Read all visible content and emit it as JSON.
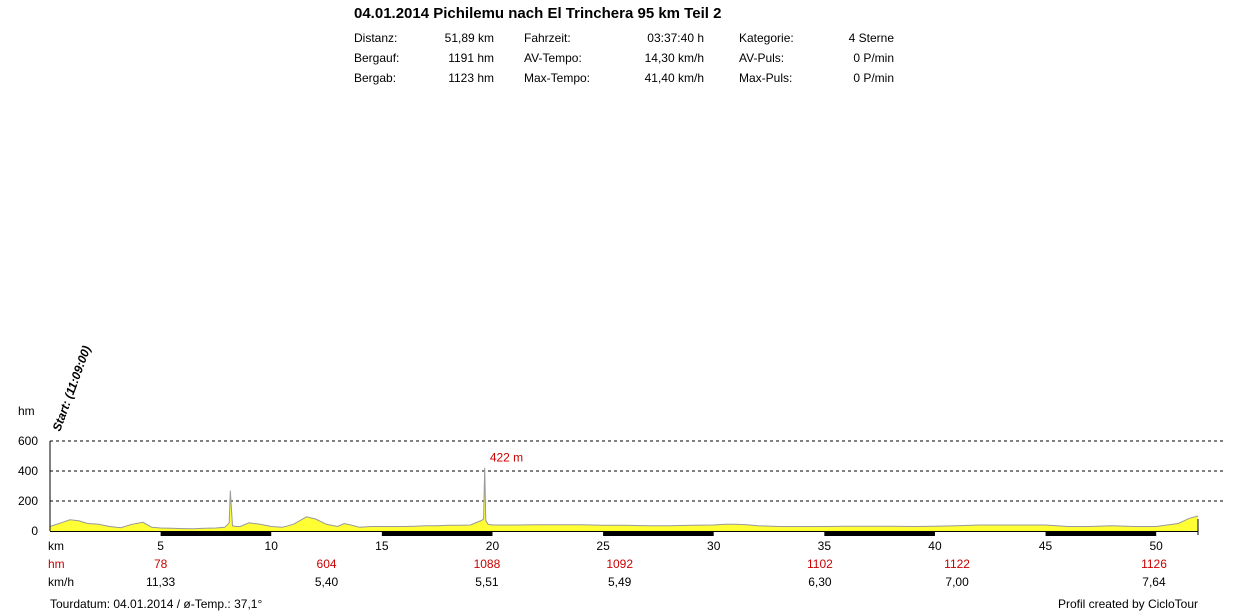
{
  "header": {
    "title": "04.01.2014 Pichilemu nach El Trinchera 95 km Teil 2",
    "stats": [
      {
        "label": "Distanz:",
        "value": "51,89 km"
      },
      {
        "label": "Bergauf:",
        "value": "1191 hm"
      },
      {
        "label": "Bergab:",
        "value": "1123 hm"
      },
      {
        "label": "Fahrzeit:",
        "value": "03:37:40 h"
      },
      {
        "label": "AV-Tempo:",
        "value": "14,30 km/h"
      },
      {
        "label": "Max-Tempo:",
        "value": "41,40 km/h"
      },
      {
        "label": "Kategorie:",
        "value": "4 Sterne"
      },
      {
        "label": "AV-Puls:",
        "value": "0 P/min"
      },
      {
        "label": "Max-Puls:",
        "value": "0 P/min"
      }
    ]
  },
  "footer": {
    "left": "Tourdatum: 04.01.2014  /  ø-Temp.: 37,1°",
    "right": "Profil created by CicloTour"
  },
  "chart_data": {
    "type": "area",
    "xlabel": "km",
    "ylabel": "hm",
    "xlim": [
      0,
      51.89
    ],
    "ylim": [
      0,
      600
    ],
    "x_ticks": [
      5,
      10,
      15,
      20,
      25,
      30,
      35,
      40,
      45,
      50
    ],
    "y_ticks": [
      0,
      200,
      400,
      600
    ],
    "grid": "horizontal dashed",
    "start_label": "Start: (11:09:00)",
    "annotations": [
      {
        "x": 19.7,
        "y": 422,
        "text": "422 m"
      }
    ],
    "colors": {
      "fill": "#ffff33",
      "line": "#999999",
      "marker": "#cc0000"
    },
    "series": [
      {
        "x": [
          0,
          0.5,
          0.9,
          1.3,
          1.7,
          2.2,
          2.7,
          3.2,
          3.7,
          4.2,
          4.6,
          5.0,
          5.5,
          6.0,
          6.5,
          7.0,
          7.5,
          7.9,
          8.1,
          8.15,
          8.25,
          8.4,
          8.6,
          9.0,
          9.5,
          10.0,
          10.5,
          11.0,
          11.6,
          12.0,
          12.5,
          13.0,
          13.3,
          13.6,
          14.0,
          14.5,
          15.0,
          15.5,
          16.0,
          16.5,
          17.0,
          17.5,
          18.0,
          18.5,
          19.0,
          19.5,
          19.6,
          19.65,
          19.7,
          19.8,
          20.0,
          21.0,
          22.0,
          23.0,
          24.0,
          25.0,
          26.0,
          27.0,
          28.0,
          29.0,
          30.0,
          30.5,
          31.0,
          31.5,
          32.0,
          33.0,
          34.0,
          35.0,
          36.0,
          37.0,
          38.0,
          39.0,
          40.0,
          41.0,
          42.0,
          43.0,
          44.0,
          45.0,
          46.0,
          47.0,
          48.0,
          49.0,
          50.0,
          50.5,
          51.0,
          51.5,
          51.89
        ],
        "y": [
          30,
          55,
          75,
          68,
          50,
          45,
          30,
          22,
          45,
          58,
          25,
          20,
          18,
          16,
          15,
          18,
          20,
          25,
          55,
          270,
          35,
          30,
          30,
          55,
          45,
          30,
          25,
          45,
          95,
          80,
          45,
          30,
          50,
          40,
          25,
          30,
          30,
          30,
          30,
          32,
          35,
          35,
          38,
          38,
          40,
          70,
          80,
          422,
          70,
          45,
          40,
          40,
          42,
          42,
          42,
          38,
          38,
          35,
          35,
          38,
          40,
          45,
          45,
          42,
          35,
          30,
          30,
          30,
          32,
          32,
          32,
          30,
          32,
          35,
          40,
          40,
          40,
          40,
          30,
          30,
          35,
          30,
          30,
          40,
          50,
          85,
          100
        ]
      }
    ],
    "table": {
      "row_labels": [
        "km",
        "hm",
        "km/h"
      ],
      "hm": [
        {
          "x": 5,
          "v": "78"
        },
        {
          "x": 12.5,
          "v": "604"
        },
        {
          "x": 19.75,
          "v": "1088"
        },
        {
          "x": 25.75,
          "v": "1092"
        },
        {
          "x": 34.8,
          "v": "1102"
        },
        {
          "x": 41.0,
          "v": "1122"
        },
        {
          "x": 49.9,
          "v": "1126"
        }
      ],
      "kmh": [
        {
          "x": 5,
          "v": "11,33"
        },
        {
          "x": 12.5,
          "v": "5,40"
        },
        {
          "x": 19.75,
          "v": "5,51"
        },
        {
          "x": 25.75,
          "v": "5,49"
        },
        {
          "x": 34.8,
          "v": "6,30"
        },
        {
          "x": 41.0,
          "v": "7,00"
        },
        {
          "x": 49.9,
          "v": "7,64"
        }
      ]
    }
  }
}
